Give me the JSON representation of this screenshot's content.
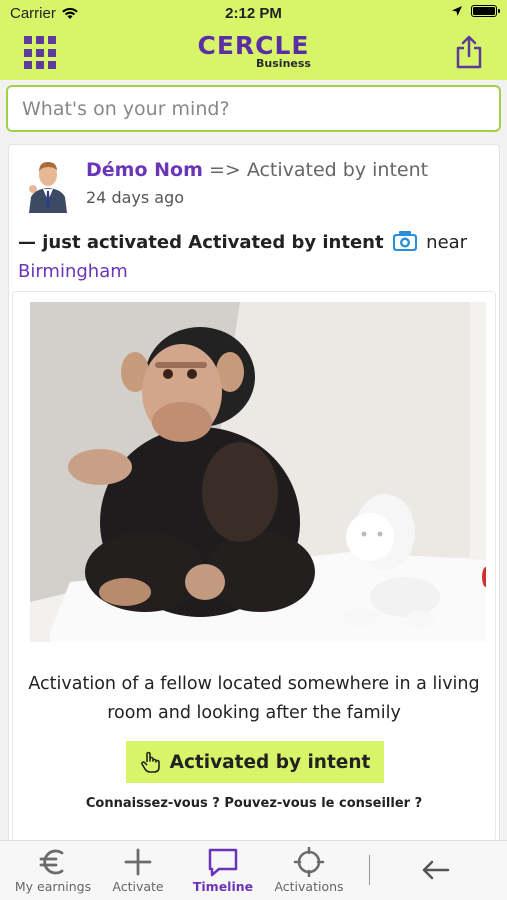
{
  "status_bar": {
    "carrier": "Carrier",
    "time": "2:12 PM"
  },
  "header": {
    "brand_main": "CERCLE",
    "brand_sub": "Business"
  },
  "composer": {
    "placeholder": "What's on your mind?"
  },
  "post": {
    "author_name": "Démo Nom",
    "author_action": "=> Activated by intent",
    "time_ago": "24 days ago",
    "activity_prefix": "— just activated Activated by intent",
    "activity_near": "near",
    "location": "Birmingham",
    "caption": "Activation of a fellow located somewhere in a living room and looking after the family",
    "cta_label": "Activated by intent",
    "question": "Connaissez-vous ? Pouvez-vous le conseiller ?"
  },
  "tabs": [
    {
      "label": "My earnings",
      "icon": "euro-icon"
    },
    {
      "label": "Activate",
      "icon": "plus-icon"
    },
    {
      "label": "Timeline",
      "icon": "chat-icon",
      "active": true
    },
    {
      "label": "Activations",
      "icon": "crosshair-icon"
    }
  ],
  "colors": {
    "accent_green": "#d8f56a",
    "brand_purple": "#6b35b8"
  }
}
